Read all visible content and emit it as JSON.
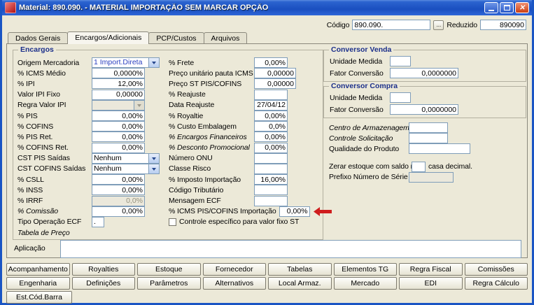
{
  "window": {
    "title": "Material: 890.090. - MATERIAL IMPORTAÇÃO SEM MARCAR OPÇÃO"
  },
  "header": {
    "codigo_label": "Código",
    "codigo_value": "890.090.",
    "browse_label": "...",
    "reduzido_label": "Reduzido",
    "reduzido_value": "890090"
  },
  "tabs": {
    "dados_gerais": "Dados Gerais",
    "encargos": "Encargos/Adicionais",
    "pcp": "PCP/Custos",
    "arquivos": "Arquivos"
  },
  "encargos": {
    "title": "Encargos",
    "left": [
      {
        "label": "Origem Mercadoria",
        "value": "1 Import.Direta"
      },
      {
        "label": "% ICMS Médio",
        "value": "0,0000%"
      },
      {
        "label": "% IPI",
        "value": "12,00%"
      },
      {
        "label": "Valor IPI Fixo",
        "value": "0,00000"
      },
      {
        "label": "Regra Valor IPI",
        "value": ""
      },
      {
        "label": "% PIS",
        "value": "0,00%"
      },
      {
        "label": "% COFINS",
        "value": "0,00%"
      },
      {
        "label": "% PIS Ret.",
        "value": "0,00%"
      },
      {
        "label": "% COFINS Ret.",
        "value": "0,00%"
      },
      {
        "label": "CST PIS Saídas",
        "value": "Nenhum"
      },
      {
        "label": "CST COFINS Saídas",
        "value": "Nenhum"
      },
      {
        "label": "% CSLL",
        "value": "0,00%"
      },
      {
        "label": "% INSS",
        "value": "0,00%"
      },
      {
        "label": "% IRRF",
        "value": "0,0%"
      },
      {
        "label": "% Comissão",
        "value": "0,00%"
      },
      {
        "label": "Tipo Operação ECF",
        "value": "."
      },
      {
        "label": "Tabela de Preço",
        "value": ""
      }
    ],
    "mid": [
      {
        "label": "% Frete",
        "value": "0,00%"
      },
      {
        "label": "Preço unitário pauta ICMS",
        "value": "0,00000"
      },
      {
        "label": "Preço ST PIS/COFINS",
        "value": "0,00000"
      },
      {
        "label": "% Reajuste",
        "value": ""
      },
      {
        "label": "Data Reajuste",
        "value": "27/04/12"
      },
      {
        "label": "% Royaltie",
        "value": "0,00%"
      },
      {
        "label": "% Custo Embalagem",
        "value": "0,0%"
      },
      {
        "label": "% Encargos Financeiros",
        "value": "0,00%"
      },
      {
        "label": "% Desconto Promocional",
        "value": "0,00%"
      },
      {
        "label": "Número ONU",
        "value": ""
      },
      {
        "label": "Classe Risco",
        "value": ""
      },
      {
        "label": "% Imposto Importação",
        "value": "16,00%"
      },
      {
        "label": "Código Tributário",
        "value": ""
      },
      {
        "label": "Mensagem ECF",
        "value": ""
      },
      {
        "label": "% ICMS PIS/COFINS Importação",
        "value": "0,00%"
      }
    ],
    "checkbox_label": "Controle específico para valor fixo ST"
  },
  "conversor_venda": {
    "title": "Conversor Venda",
    "unidade_label": "Unidade Medida",
    "unidade_value": "",
    "fator_label": "Fator Conversão",
    "fator_value": "0,0000000"
  },
  "conversor_compra": {
    "title": "Conversor Compra",
    "unidade_label": "Unidade Medida",
    "unidade_value": "",
    "fator_label": "Fator Conversão",
    "fator_value": "0,0000000"
  },
  "right_panel": {
    "centro_label": "Centro de Armazenagem",
    "centro_value": "",
    "controle_label": "Controle Solicitação",
    "controle_value": "",
    "qualidade_label": "Qualidade do Produto",
    "qualidade_value": "",
    "zerar_label": "Zerar estoque com saldo na",
    "zerar_value": "",
    "zerar_suffix": "casa decimal.",
    "prefixo_label": "Prefixo Número de Série",
    "prefixo_value": ""
  },
  "aplicacao": {
    "label": "Aplicação",
    "value": ""
  },
  "buttons": {
    "row1": [
      "Acompanhamento",
      "Royalties",
      "Estoque",
      "Fornecedor",
      "Tabelas",
      "Elementos TG",
      "Regra Fiscal",
      "Comissões"
    ],
    "row2": [
      "Engenharia",
      "Definições",
      "Parâmetros",
      "Alternativos",
      "Local Armaz.",
      "Mercado",
      "EDI",
      "Regra Cálculo"
    ],
    "row3": [
      "Est.Cód.Barra"
    ]
  },
  "colors": {
    "titlebar": "#1a55c4",
    "annotation_arrow": "#cf1d1d",
    "input_border": "#7F9DB9"
  }
}
